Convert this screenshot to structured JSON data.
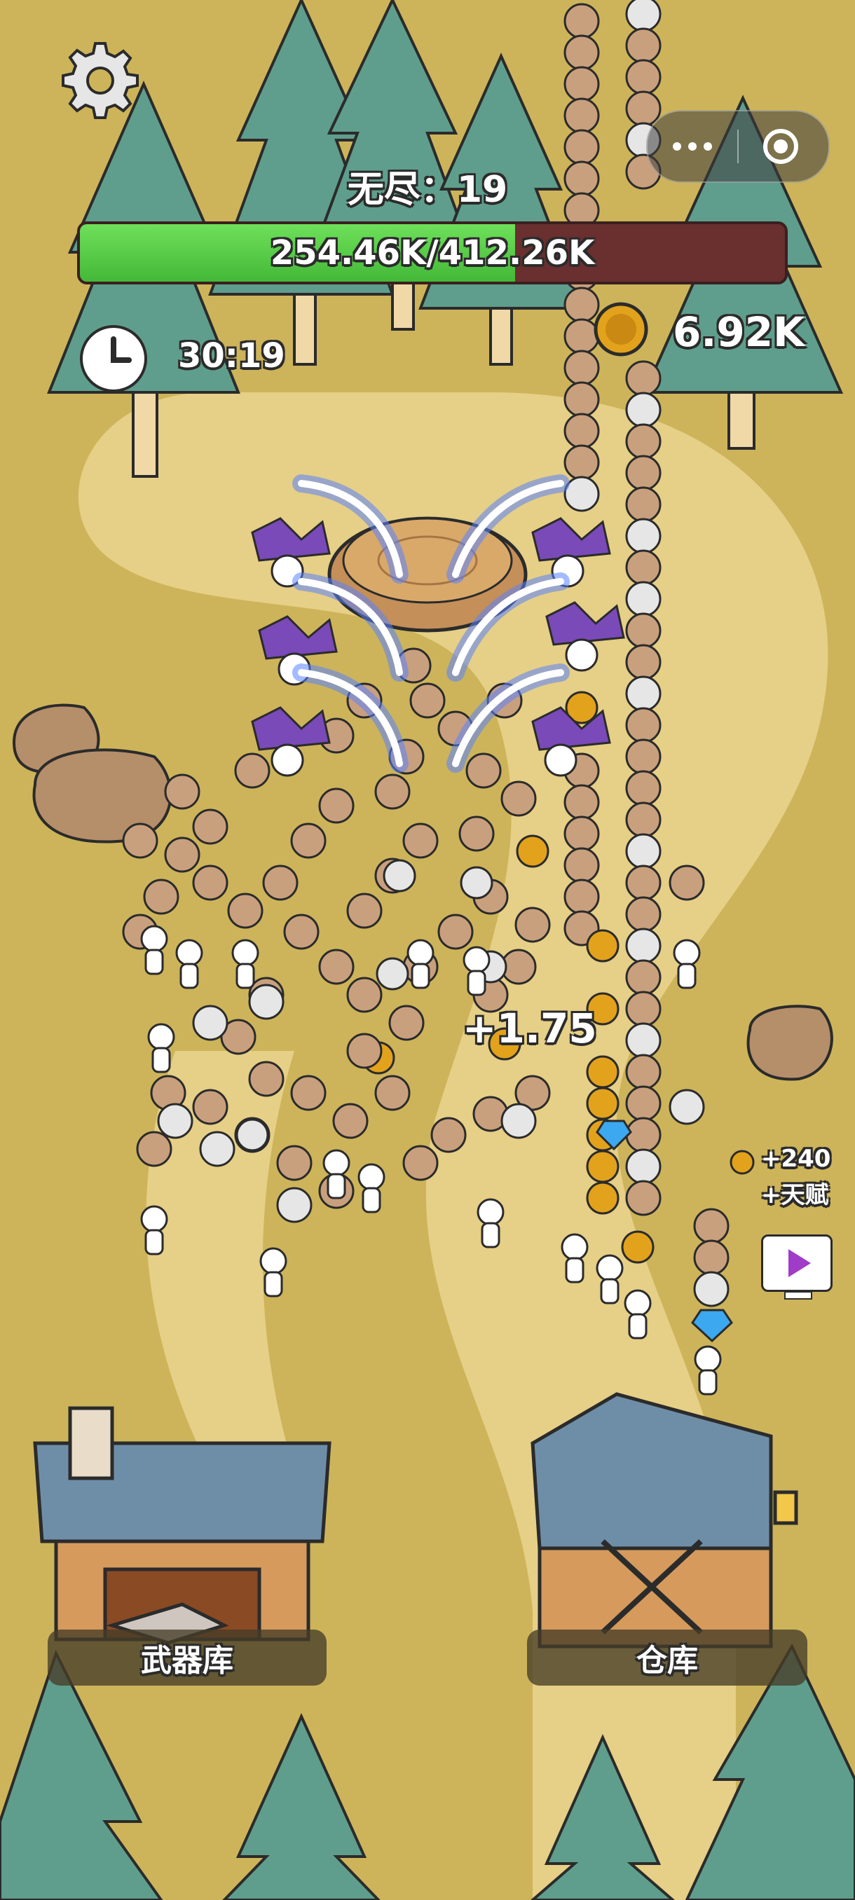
{
  "hud": {
    "settings_icon": "gear-icon",
    "wave_label": "无尽：19",
    "hp_current": 254.46,
    "hp_max": 412.26,
    "hp_text": "254.46K/412.26K",
    "timer_icon": "clock-icon",
    "timer": "30:19",
    "coin_icon": "gold-coin-icon",
    "coins": "6.92K"
  },
  "system_capsule": {
    "menu_icon": "more-dots-icon",
    "close_icon": "close-circle-icon"
  },
  "floating": {
    "gain": "+1.75",
    "bonus_coins": "+240",
    "bonus_talent": "+天赋",
    "ad_icon": "video-play-icon"
  },
  "buildings": {
    "armory_label": "武器库",
    "warehouse_label": "仓库"
  },
  "colors": {
    "ground": "#cdb45a",
    "path": "#e6cf86",
    "tree": "#5f9e8c",
    "hp_fill": "#5fd24c",
    "hp_empty": "#6a2f2f",
    "coin": "#e2a21c"
  }
}
